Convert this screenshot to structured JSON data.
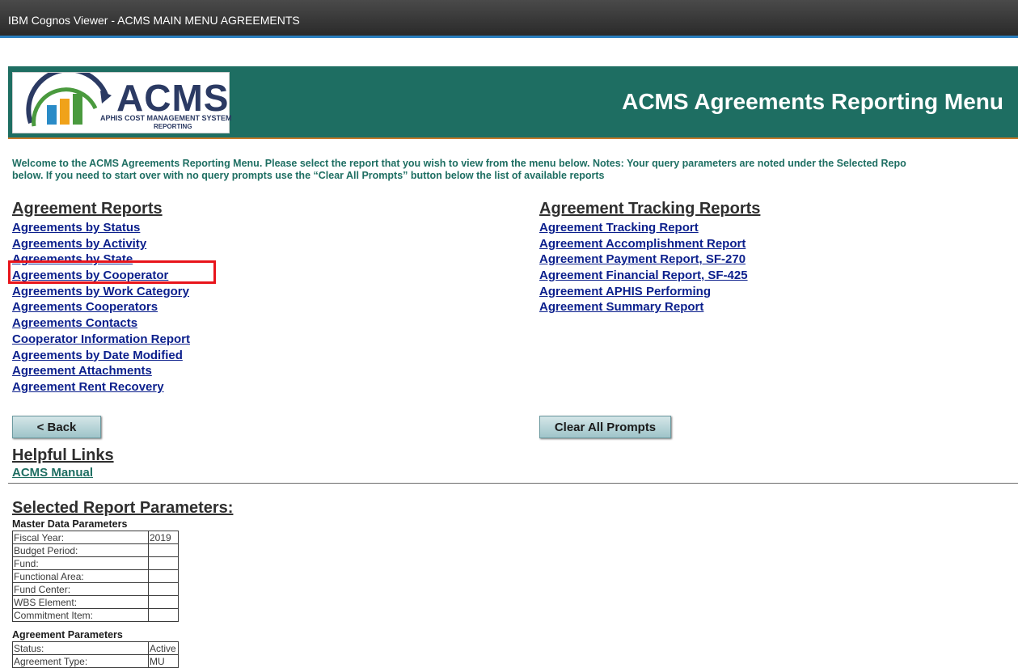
{
  "window": {
    "title": "IBM Cognos Viewer - ACMS MAIN MENU AGREEMENTS"
  },
  "logo": {
    "name": "ACMS",
    "subtitle": "APHIS COST MANAGEMENT SYSTEM",
    "subtitle2": "REPORTING"
  },
  "banner": {
    "title": "ACMS Agreements Reporting Menu"
  },
  "welcome": {
    "line1": "Welcome to the ACMS Agreements Reporting Menu.  Please select the report that you wish to view from the menu below.  Notes: Your query parameters are noted under the Selected Repo",
    "line2": "below.  If you need to start over with no query prompts use the “Clear All Prompts” button below the list of available reports"
  },
  "agreement_reports": {
    "title": "Agreement Reports",
    "items": [
      "Agreements by Status",
      "Agreements by Activity",
      "Agreements by State",
      "Agreements by Cooperator",
      "Agreements by Work Category",
      "Agreements Cooperators",
      "Agreements Contacts",
      "Cooperator Information Report",
      "Agreements by Date Modified",
      "Agreement Attachments",
      "Agreement Rent Recovery"
    ]
  },
  "tracking_reports": {
    "title": "Agreement Tracking Reports",
    "items": [
      "Agreement Tracking Report",
      "Agreement Accomplishment Report",
      "Agreement Payment Report, SF-270",
      "Agreement Financial Report, SF-425",
      "Agreement APHIS Performing",
      "Agreement Summary Report"
    ]
  },
  "buttons": {
    "back": "< Back",
    "clear": "Clear All Prompts"
  },
  "helpful": {
    "title": "Helpful Links",
    "manual": "ACMS Manual"
  },
  "params": {
    "title": "Selected Report Parameters:",
    "master_heading": "Master Data Parameters",
    "master": [
      {
        "label": "Fiscal Year:",
        "value": "2019"
      },
      {
        "label": "Budget Period:",
        "value": ""
      },
      {
        "label": "Fund:",
        "value": ""
      },
      {
        "label": "Functional Area:",
        "value": ""
      },
      {
        "label": "Fund Center:",
        "value": ""
      },
      {
        "label": "WBS Element:",
        "value": ""
      },
      {
        "label": "Commitment Item:",
        "value": ""
      }
    ],
    "agreement_heading": "Agreement Parameters",
    "agreement": [
      {
        "label": "Status:",
        "value": "Active"
      },
      {
        "label": "Agreement Type:",
        "value": "MU"
      }
    ]
  },
  "colors": {
    "banner": "#1e6e62",
    "link": "#0b1f8c",
    "highlight": "#e8141b",
    "accent": "#2b7fc0"
  }
}
